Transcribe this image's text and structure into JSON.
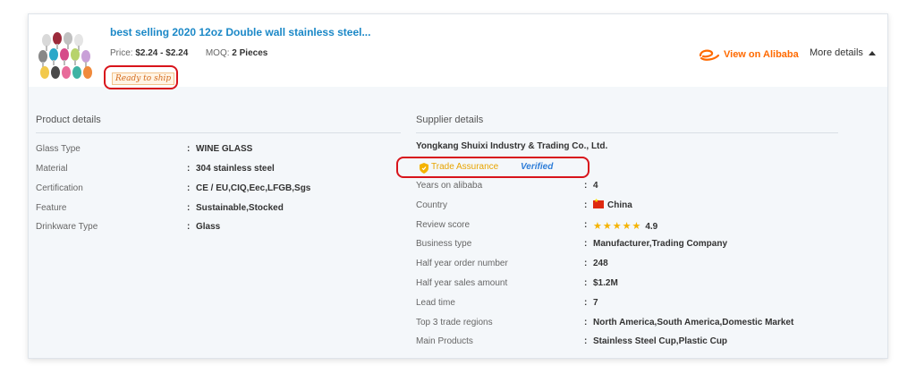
{
  "product": {
    "title": "best selling 2020 12oz Double wall stainless steel...",
    "price_label": "Price:",
    "price_value": "$2.24 - $2.24",
    "moq_label": "MOQ:",
    "moq_value": "2 Pieces",
    "badge": "Ready to ship",
    "thumbnail_icon": "cups-thumbnail"
  },
  "actions": {
    "view_on": "View on Alibaba",
    "more_details": "More details"
  },
  "product_details": {
    "title": "Product details",
    "separator": ":",
    "rows": [
      {
        "label": "Glass Type",
        "value": "WINE GLASS"
      },
      {
        "label": "Material",
        "value": "304 stainless steel"
      },
      {
        "label": "Certification",
        "value": "CE / EU,CIQ,Eec,LFGB,Sgs"
      },
      {
        "label": "Feature",
        "value": "Sustainable,Stocked"
      },
      {
        "label": "Drinkware Type",
        "value": "Glass"
      }
    ]
  },
  "supplier_details": {
    "title": "Supplier details",
    "company": "Yongkang Shuixi Industry & Trading Co., Ltd.",
    "trade_assurance": "Trade Assurance",
    "verified": "Verified",
    "separator": ":",
    "rows": [
      {
        "label": "Years on alibaba",
        "value": "4"
      },
      {
        "label": "Country",
        "value": "China"
      },
      {
        "label": "Review score",
        "value": "4.9",
        "stars": "★★★★★"
      },
      {
        "label": "Business type",
        "value": "Manufacturer,Trading Company"
      },
      {
        "label": "Half year order number",
        "value": "248"
      },
      {
        "label": "Half year sales amount",
        "value": "$1.2M"
      },
      {
        "label": "Lead time",
        "value": "7"
      },
      {
        "label": "Top 3 trade regions",
        "value": "North America,South America,Domestic Market"
      },
      {
        "label": "Main Products",
        "value": "Stainless Steel Cup,Plastic Cup"
      }
    ]
  },
  "colors": {
    "link": "#1b88c7",
    "alibaba_orange": "#ff6a00",
    "highlight_red": "#d8141b"
  }
}
